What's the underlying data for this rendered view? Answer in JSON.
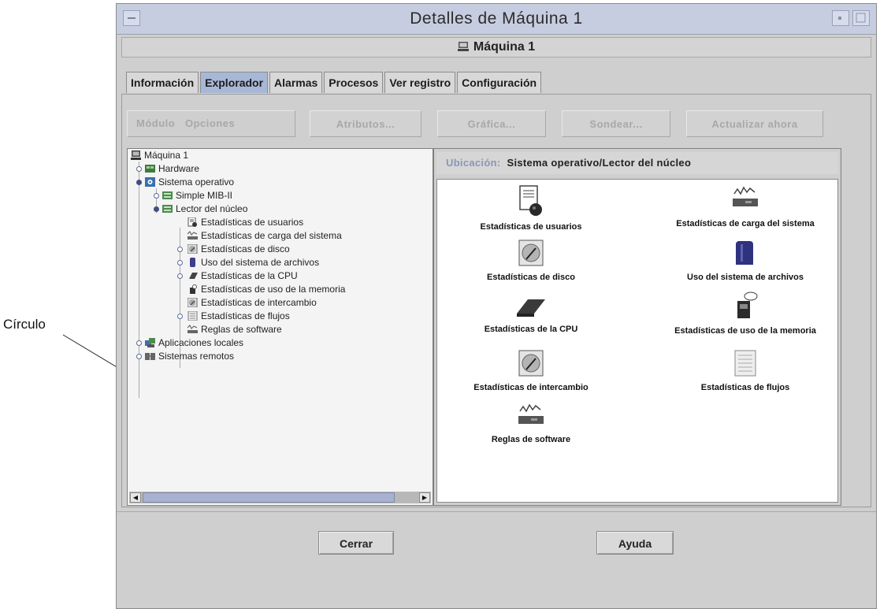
{
  "callout": {
    "label": "Círculo"
  },
  "window": {
    "title": "Detalles de Máquina 1",
    "subtitle": "Máquina 1"
  },
  "tabs": [
    {
      "label": "Información",
      "active": false
    },
    {
      "label": "Explorador",
      "active": true
    },
    {
      "label": "Alarmas",
      "active": false
    },
    {
      "label": "Procesos",
      "active": false
    },
    {
      "label": "Ver registro",
      "active": false
    },
    {
      "label": "Configuración",
      "active": false
    }
  ],
  "toolbar": {
    "module_label": "Módulo",
    "options_label": "Opciones",
    "attributes_label": "Atributos...",
    "graph_label": "Gráfica...",
    "probe_label": "Sondear...",
    "refresh_label": "Actualizar ahora"
  },
  "tree": {
    "items": [
      {
        "label": "Máquina 1",
        "icon": "host-icon"
      },
      {
        "label": "Hardware",
        "icon": "hardware-icon"
      },
      {
        "label": "Sistema operativo",
        "icon": "os-icon"
      },
      {
        "label": "Simple MIB-II",
        "icon": "mib-icon"
      },
      {
        "label": "Lector del núcleo",
        "icon": "kernel-reader-icon"
      },
      {
        "label": "Estadísticas de usuarios",
        "icon": "user-stats-icon"
      },
      {
        "label": "Estadísticas de carga del sistema",
        "icon": "load-stats-icon"
      },
      {
        "label": "Estadísticas de disco",
        "icon": "disk-stats-icon"
      },
      {
        "label": "Uso del sistema de archivos",
        "icon": "filesystem-icon"
      },
      {
        "label": "Estadísticas de la CPU",
        "icon": "cpu-icon"
      },
      {
        "label": "Estadísticas de uso de la memoria",
        "icon": "memory-icon"
      },
      {
        "label": "Estadísticas de intercambio",
        "icon": "swap-icon"
      },
      {
        "label": "Estadísticas de flujos",
        "icon": "streams-icon"
      },
      {
        "label": "Reglas de software",
        "icon": "software-rules-icon"
      },
      {
        "label": "Aplicaciones locales",
        "icon": "local-apps-icon"
      },
      {
        "label": "Sistemas remotos",
        "icon": "remote-systems-icon"
      }
    ]
  },
  "location": {
    "label": "Ubicación:",
    "path": "Sistema operativo/Lector del núcleo"
  },
  "icon_view": {
    "items": [
      {
        "label": "Estadísticas de usuarios",
        "icon": "user-stats-icon"
      },
      {
        "label": "Estadísticas de carga del sistema",
        "icon": "load-stats-icon"
      },
      {
        "label": "Estadísticas de disco",
        "icon": "disk-stats-icon"
      },
      {
        "label": "Uso del sistema de archivos",
        "icon": "filesystem-icon"
      },
      {
        "label": "Estadísticas de la CPU",
        "icon": "cpu-icon"
      },
      {
        "label": "Estadísticas de uso de la memoria",
        "icon": "memory-icon"
      },
      {
        "label": "Estadísticas de intercambio",
        "icon": "swap-icon"
      },
      {
        "label": "Estadísticas de flujos",
        "icon": "streams-icon"
      },
      {
        "label": "Reglas de software",
        "icon": "software-rules-icon"
      }
    ]
  },
  "footer": {
    "close_label": "Cerrar",
    "help_label": "Ayuda"
  },
  "colors": {
    "title_bar": "#c7cde0",
    "active_tab": "#a7b7d6",
    "window_bg": "#cfcfcf"
  }
}
